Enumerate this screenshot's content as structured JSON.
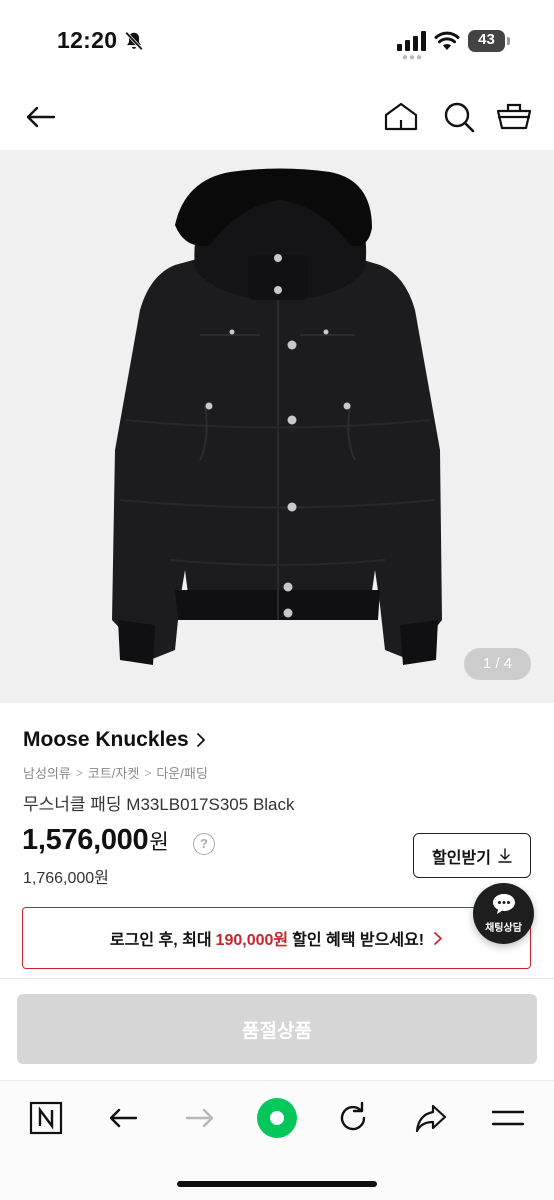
{
  "status": {
    "time": "12:20",
    "battery": "43"
  },
  "header": {
    "back_icon": "arrow-left-icon",
    "home_icon": "home-icon",
    "search_icon": "search-icon",
    "cart_icon": "basket-icon"
  },
  "gallery": {
    "counter": "1 / 4"
  },
  "product": {
    "brand": "Moose Knuckles",
    "breadcrumb": [
      "남성의류",
      "코트/자켓",
      "다운/패딩"
    ],
    "name": "무스너클 패딩 M33LB017S305 Black",
    "price": "1,576,000",
    "price_unit": "원",
    "price_help": "?",
    "original_price": "1,766,000원"
  },
  "coupon": {
    "label": "할인받기"
  },
  "chat": {
    "label": "채팅상담"
  },
  "promo": {
    "before": "로그인 후, 최대",
    "amount": "190,000원",
    "after": "할인 혜택 받으세요!"
  },
  "purchase": {
    "soldout_label": "품절상품"
  },
  "colors": {
    "accent_red": "#c8252c",
    "naver_green": "#03c75a",
    "disabled_gray": "#d6d6d6"
  }
}
